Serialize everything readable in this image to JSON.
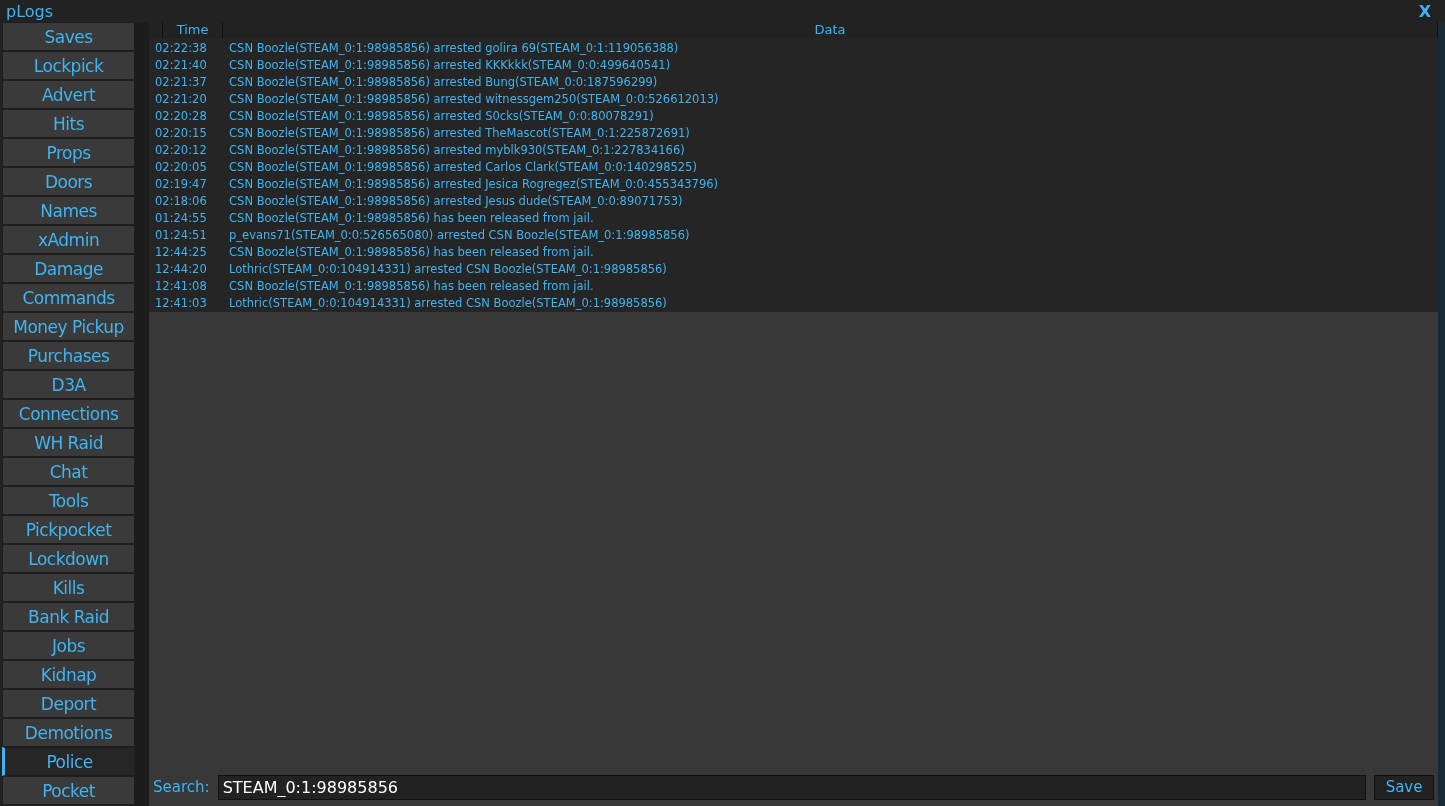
{
  "window": {
    "title": "pLogs",
    "close": "X"
  },
  "sidebar": {
    "items": [
      {
        "label": "Saves",
        "selected": false
      },
      {
        "label": "Lockpick",
        "selected": false
      },
      {
        "label": "Advert",
        "selected": false
      },
      {
        "label": "Hits",
        "selected": false
      },
      {
        "label": "Props",
        "selected": false
      },
      {
        "label": "Doors",
        "selected": false
      },
      {
        "label": "Names",
        "selected": false
      },
      {
        "label": "xAdmin",
        "selected": false
      },
      {
        "label": "Damage",
        "selected": false
      },
      {
        "label": "Commands",
        "selected": false
      },
      {
        "label": "Money Pickup",
        "selected": false
      },
      {
        "label": "Purchases",
        "selected": false
      },
      {
        "label": "D3A",
        "selected": false
      },
      {
        "label": "Connections",
        "selected": false
      },
      {
        "label": "WH Raid",
        "selected": false
      },
      {
        "label": "Chat",
        "selected": false
      },
      {
        "label": "Tools",
        "selected": false
      },
      {
        "label": "Pickpocket",
        "selected": false
      },
      {
        "label": "Lockdown",
        "selected": false
      },
      {
        "label": "Kills",
        "selected": false
      },
      {
        "label": "Bank Raid",
        "selected": false
      },
      {
        "label": "Jobs",
        "selected": false
      },
      {
        "label": "Kidnap",
        "selected": false
      },
      {
        "label": "Deport",
        "selected": false
      },
      {
        "label": "Demotions",
        "selected": false
      },
      {
        "label": "Police",
        "selected": true
      },
      {
        "label": "Pocket",
        "selected": false
      }
    ]
  },
  "table": {
    "columns": [
      "Time",
      "Data"
    ],
    "rows": [
      {
        "time": "02:22:38",
        "data": "CSN Boozle(STEAM_0:1:98985856) arrested golira 69(STEAM_0:1:119056388)"
      },
      {
        "time": "02:21:40",
        "data": "CSN Boozle(STEAM_0:1:98985856) arrested KKKkkk(STEAM_0:0:499640541)"
      },
      {
        "time": "02:21:37",
        "data": "CSN Boozle(STEAM_0:1:98985856) arrested Bung(STEAM_0:0:187596299)"
      },
      {
        "time": "02:21:20",
        "data": "CSN Boozle(STEAM_0:1:98985856) arrested witnessgem250(STEAM_0:0:526612013)"
      },
      {
        "time": "02:20:28",
        "data": "CSN Boozle(STEAM_0:1:98985856) arrested S0cks(STEAM_0:0:80078291)"
      },
      {
        "time": "02:20:15",
        "data": "CSN Boozle(STEAM_0:1:98985856) arrested TheMascot(STEAM_0:1:225872691)"
      },
      {
        "time": "02:20:12",
        "data": "CSN Boozle(STEAM_0:1:98985856) arrested myblk930(STEAM_0:1:227834166)"
      },
      {
        "time": "02:20:05",
        "data": "CSN Boozle(STEAM_0:1:98985856) arrested Carlos Clark(STEAM_0:0:140298525)"
      },
      {
        "time": "02:19:47",
        "data": "CSN Boozle(STEAM_0:1:98985856) arrested Jesica Rogregez(STEAM_0:0:455343796)"
      },
      {
        "time": "02:18:06",
        "data": "CSN Boozle(STEAM_0:1:98985856) arrested Jesus dude(STEAM_0:0:89071753)"
      },
      {
        "time": "01:24:55",
        "data": "CSN Boozle(STEAM_0:1:98985856) has been released from jail."
      },
      {
        "time": "01:24:51",
        "data": "p_evans71(STEAM_0:0:526565080) arrested CSN Boozle(STEAM_0:1:98985856)"
      },
      {
        "time": "12:44:25",
        "data": "CSN Boozle(STEAM_0:1:98985856) has been released from jail."
      },
      {
        "time": "12:44:20",
        "data": "Lothric(STEAM_0:0:104914331) arrested CSN Boozle(STEAM_0:1:98985856)"
      },
      {
        "time": "12:41:08",
        "data": "CSN Boozle(STEAM_0:1:98985856) has been released from jail."
      },
      {
        "time": "12:41:03",
        "data": "Lothric(STEAM_0:0:104914331) arrested CSN Boozle(STEAM_0:1:98985856)"
      }
    ]
  },
  "search": {
    "label": "Search:",
    "value": "STEAM_0:1:98985856",
    "button": "Save"
  }
}
